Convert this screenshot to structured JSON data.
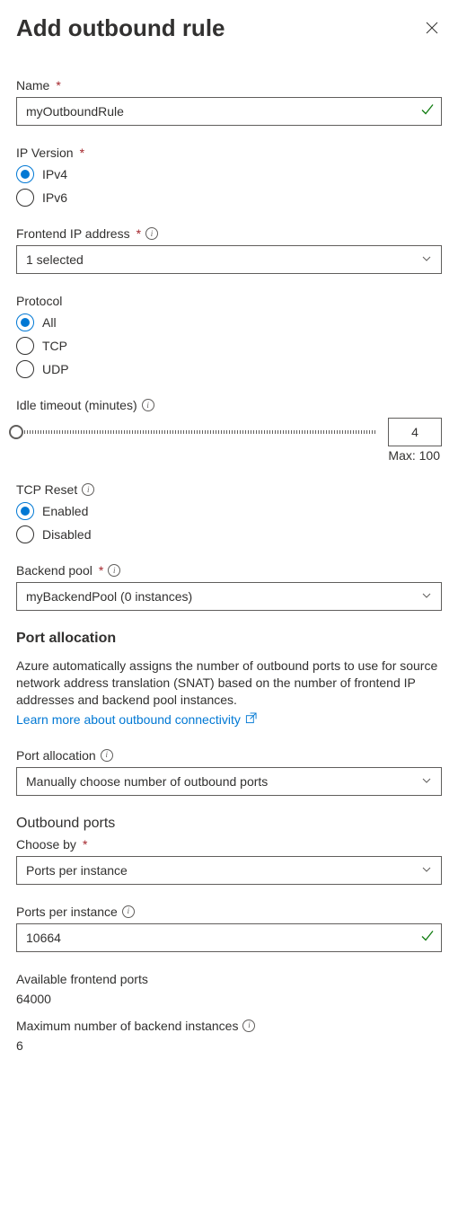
{
  "header": {
    "title": "Add outbound rule"
  },
  "name": {
    "label": "Name",
    "value": "myOutboundRule"
  },
  "ipVersion": {
    "label": "IP Version",
    "options": [
      "IPv4",
      "IPv6"
    ],
    "selected": "IPv4"
  },
  "frontendIp": {
    "label": "Frontend IP address",
    "value": "1 selected"
  },
  "protocol": {
    "label": "Protocol",
    "options": [
      "All",
      "TCP",
      "UDP"
    ],
    "selected": "All"
  },
  "idleTimeout": {
    "label": "Idle timeout (minutes)",
    "value": "4",
    "maxLabel": "Max: 100"
  },
  "tcpReset": {
    "label": "TCP Reset",
    "options": [
      "Enabled",
      "Disabled"
    ],
    "selected": "Enabled"
  },
  "backendPool": {
    "label": "Backend pool",
    "value": "myBackendPool (0 instances)"
  },
  "portAllocation": {
    "heading": "Port allocation",
    "description": "Azure automatically assigns the number of outbound ports to use for source network address translation (SNAT) based on the number of frontend IP addresses and backend pool instances.",
    "linkText": "Learn more about outbound connectivity",
    "fieldLabel": "Port allocation",
    "value": "Manually choose number of outbound ports"
  },
  "outboundPorts": {
    "heading": "Outbound ports",
    "chooseByLabel": "Choose by",
    "chooseByValue": "Ports per instance",
    "portsPerInstanceLabel": "Ports per instance",
    "portsPerInstanceValue": "10664",
    "availableLabel": "Available frontend ports",
    "availableValue": "64000",
    "maxBackendLabel": "Maximum number of backend instances",
    "maxBackendValue": "6"
  }
}
